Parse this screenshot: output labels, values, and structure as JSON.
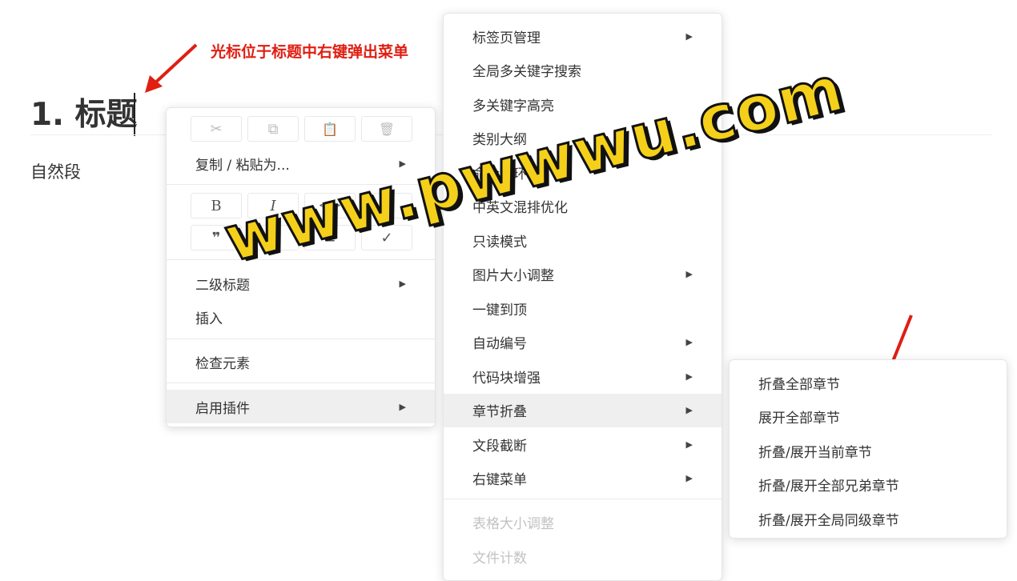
{
  "document": {
    "heading": "1. 标题",
    "paragraph": "自然段"
  },
  "annotation": {
    "text": "光标位于标题中右键弹出菜单",
    "color": "#e01e12"
  },
  "context_menu": {
    "toolbar_row1": [
      {
        "icon": "scissors-icon",
        "glyph": "✂",
        "enabled": false
      },
      {
        "icon": "copy-icon",
        "glyph": "⧉",
        "enabled": false
      },
      {
        "icon": "clipboard-icon",
        "glyph": "📋",
        "enabled": true
      },
      {
        "icon": "trash-icon",
        "glyph": "🗑",
        "enabled": false
      }
    ],
    "copy_paste_as": "复制 / 粘贴为...",
    "toolbar_row2": [
      {
        "icon": "bold-icon",
        "glyph": "B"
      },
      {
        "icon": "italic-icon",
        "glyph": "I"
      },
      {
        "icon": "code-icon",
        "glyph": "</>"
      },
      {
        "icon": "link-icon",
        "glyph": "🔗"
      }
    ],
    "toolbar_row3": [
      {
        "icon": "quote-icon",
        "glyph": "❞"
      },
      {
        "icon": "ordered-list-icon",
        "glyph": "≡"
      },
      {
        "icon": "bullet-list-icon",
        "glyph": "≡"
      },
      {
        "icon": "task-list-icon",
        "glyph": "✓"
      }
    ],
    "heading_level": "二级标题",
    "insert": "插入",
    "check_label": "检查元素",
    "enable_plugins": "启用插件"
  },
  "plugins_menu": {
    "items": [
      {
        "label": "标签页管理",
        "submenu": true
      },
      {
        "label": "全局多关键字搜索",
        "submenu": false
      },
      {
        "label": "多关键字高亮",
        "submenu": false
      },
      {
        "label": "类别大纲",
        "submenu": false
      },
      {
        "label": "命令行环境",
        "submenu": false
      },
      {
        "label": "中英文混排优化",
        "submenu": false
      },
      {
        "label": "只读模式",
        "submenu": false
      },
      {
        "label": "图片大小调整",
        "submenu": true
      },
      {
        "label": "一键到顶",
        "submenu": false
      },
      {
        "label": "自动编号",
        "submenu": true
      },
      {
        "label": "代码块增强",
        "submenu": true
      },
      {
        "label": "章节折叠",
        "submenu": true,
        "active": true
      },
      {
        "label": "文段截断",
        "submenu": true
      },
      {
        "label": "右键菜单",
        "submenu": true
      }
    ],
    "disabled_items": [
      "表格大小调整",
      "文件计数"
    ]
  },
  "fold_menu": {
    "items": [
      "折叠全部章节",
      "展开全部章节",
      "折叠/展开当前章节",
      "折叠/展开全部兄弟章节",
      "折叠/展开全局同级章节"
    ]
  },
  "watermark": {
    "text": "www.pwwwu.com",
    "color": "#f4d01a"
  }
}
